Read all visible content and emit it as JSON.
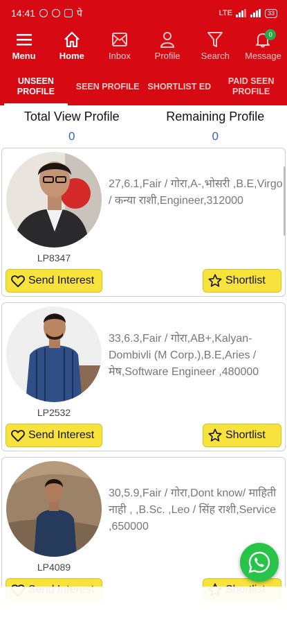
{
  "status_bar": {
    "time": "14:41",
    "extra_glyph": "पे",
    "network": "LTE",
    "battery": "33"
  },
  "nav": {
    "items": [
      {
        "label": "Menu",
        "icon": "hamburger-icon"
      },
      {
        "label": "Home",
        "icon": "home-icon"
      },
      {
        "label": "Inbox",
        "icon": "inbox-icon"
      },
      {
        "label": "Profile",
        "icon": "person-icon"
      },
      {
        "label": "Search",
        "icon": "filter-icon"
      },
      {
        "label": "Message",
        "icon": "bell-icon",
        "badge": "0"
      }
    ]
  },
  "tabs": [
    {
      "label": "UNSEEN PROFILE",
      "active": true
    },
    {
      "label": "SEEN PROFILE",
      "active": false
    },
    {
      "label": "SHORTLIST ED",
      "active": false
    },
    {
      "label": "PAID SEEN PROFILE",
      "active": false
    }
  ],
  "stats": {
    "total_label": "Total View Profile",
    "total_value": "0",
    "remaining_label": "Remaining Profile",
    "remaining_value": "0"
  },
  "buttons": {
    "send_interest": "Send Interest",
    "shortlist": "Shortlist"
  },
  "profiles": [
    {
      "id": "LP8347",
      "details": "27,6.1,Fair / गोरा,A-,भोसरी ,B.E,Virgo / कन्या राशी,Engineer,312000"
    },
    {
      "id": "LP2532",
      "details": "33,6.3,Fair / गोरा,AB+,Kalyan-Dombivli (M Corp.),B.E,Aries / मेष,Software Engineer ,480000"
    },
    {
      "id": "LP4089",
      "details": "30,5.9,Fair / गोरा,Dont know/ माहिती नाही , ,B.Sc. ,Leo / सिंह राशी,Service ,650000"
    }
  ],
  "colors": {
    "brand_red": "#d70a14",
    "button_yellow": "#f7e33c",
    "whatsapp_green": "#28c44a",
    "stat_value_blue": "#3b63b5"
  },
  "whatsapp": {
    "icon": "whatsapp-icon"
  }
}
